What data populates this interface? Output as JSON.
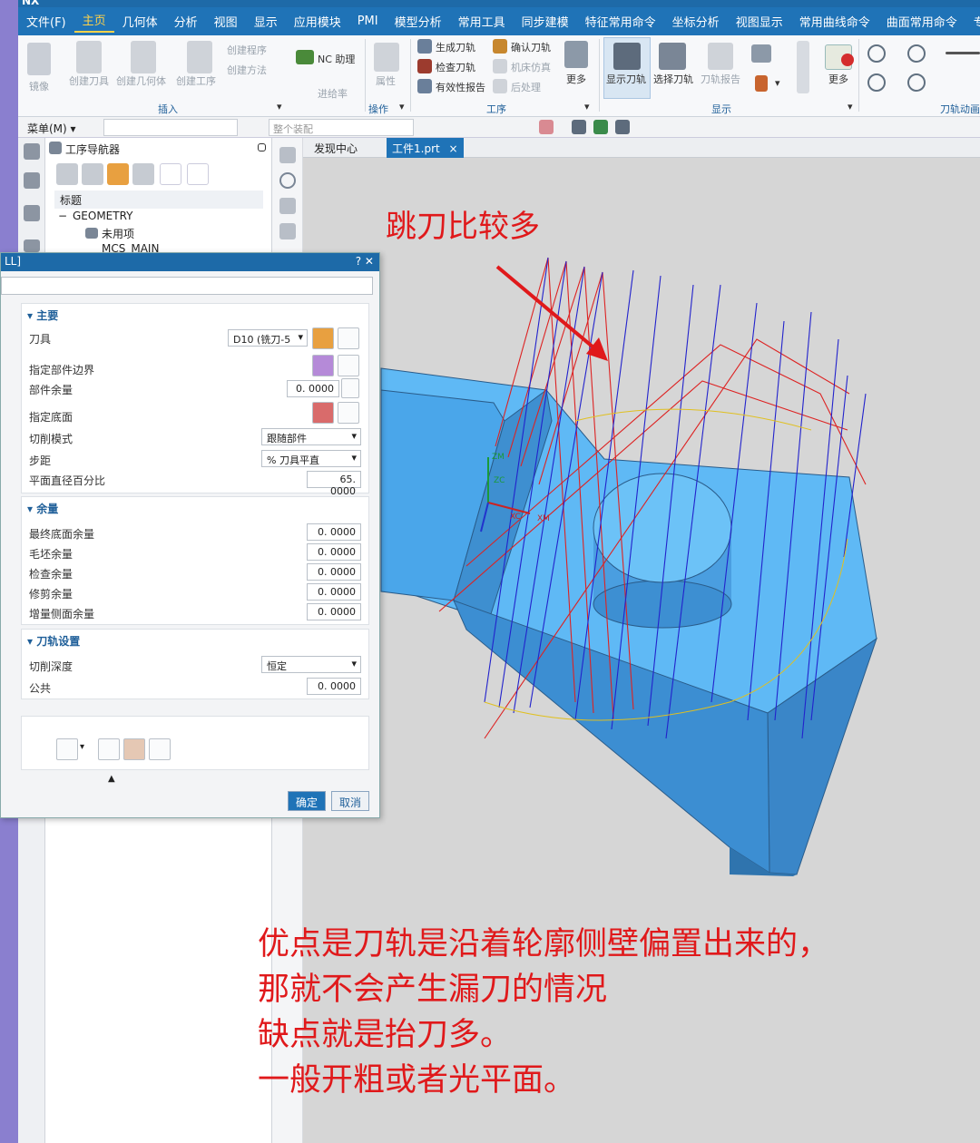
{
  "app": {
    "title": "NX"
  },
  "menubar": {
    "items": [
      "文件(F)",
      "主页",
      "几何体",
      "分析",
      "视图",
      "显示",
      "应用模块",
      "PMI",
      "模型分析",
      "常用工具",
      "同步建模",
      "特征常用命令",
      "坐标分析",
      "视图显示",
      "常用曲线命令",
      "曲面常用命令",
      "专用"
    ]
  },
  "ribbon": {
    "insert": {
      "item0": "镜像",
      "item1": "创建刀具",
      "item2": "创建几何体",
      "item3": "创建工序",
      "item4": "创建程序",
      "item5": "创建方法",
      "group": "插入"
    },
    "nc_assist": "NC 助理",
    "cutfeed": "进给率",
    "ops": {
      "attr": "属性",
      "group": "操作"
    },
    "proc": {
      "gen": "生成刀轨",
      "check": "检查刀轨",
      "report": "有效性报告",
      "confirm": "确认刀轨",
      "sim": "机床仿真",
      "post": "后处理",
      "more": "更多",
      "group": "工序"
    },
    "disp": {
      "show": "显示刀轨",
      "select": "选择刀轨",
      "report": "刀轨报告",
      "more": "更多",
      "group": "显示"
    },
    "anim_group": "刀轨动画"
  },
  "menurow": {
    "menu": "菜单(M) ▾",
    "assembly": "整个装配"
  },
  "navigator": {
    "title": "工序导航器",
    "header": "标题",
    "rows": [
      "GEOMETRY",
      "未用项",
      "MCS_MAIN"
    ]
  },
  "tabs": {
    "discover": "发现中心",
    "part": "工件1.prt",
    "close": "×"
  },
  "dialog": {
    "title": "LL]",
    "title_buttons": "?  ✕",
    "main": {
      "header": "▾ 主要",
      "tool_label": "刀具",
      "tool_value": "D10 (铣刀-5",
      "part_boundary_label": "指定部件边界",
      "part_stock_label": "部件余量",
      "part_stock_value": "0. 0000",
      "floor_label": "指定底面",
      "cut_mode_label": "切削模式",
      "cut_mode_value": "跟随部件",
      "stepover_label": "步距",
      "stepover_value": "% 刀具平直",
      "percent_label": "平面直径百分比",
      "percent_value": "65. 0000"
    },
    "stock": {
      "header": "▾ 余量",
      "final_floor_label": "最终底面余量",
      "final_floor_value": "0. 0000",
      "blank_label": "毛坯余量",
      "blank_value": "0. 0000",
      "check_label": "检查余量",
      "check_value": "0. 0000",
      "trim_label": "修剪余量",
      "trim_value": "0. 0000",
      "side_label": "增量侧面余量",
      "side_value": "0. 0000"
    },
    "path": {
      "header": "▾ 刀轨设置",
      "depth_label": "切削深度",
      "depth_value": "恒定",
      "common_label": "公共",
      "common_value": "0. 0000"
    },
    "expand": "▲",
    "ok": "确定",
    "cancel": "取消"
  },
  "annotations": {
    "top": "跳刀比较多",
    "line1": "优点是刀轨是沿着轮廓侧壁偏置出来的，",
    "line2": "那就不会产生漏刀的情况",
    "line3": "缺点就是抬刀多。",
    "line4": "一般开粗或者光平面。"
  },
  "axis_labels": {
    "zm": "ZM",
    "zc": "ZC",
    "xc": "XC",
    "xm": "XM"
  },
  "colors": {
    "accent": "#1f73b7",
    "annotation": "#e0191b",
    "model": "#5ab2f0",
    "path_cut": "#2222cc",
    "path_rapid": "#dd2222"
  }
}
